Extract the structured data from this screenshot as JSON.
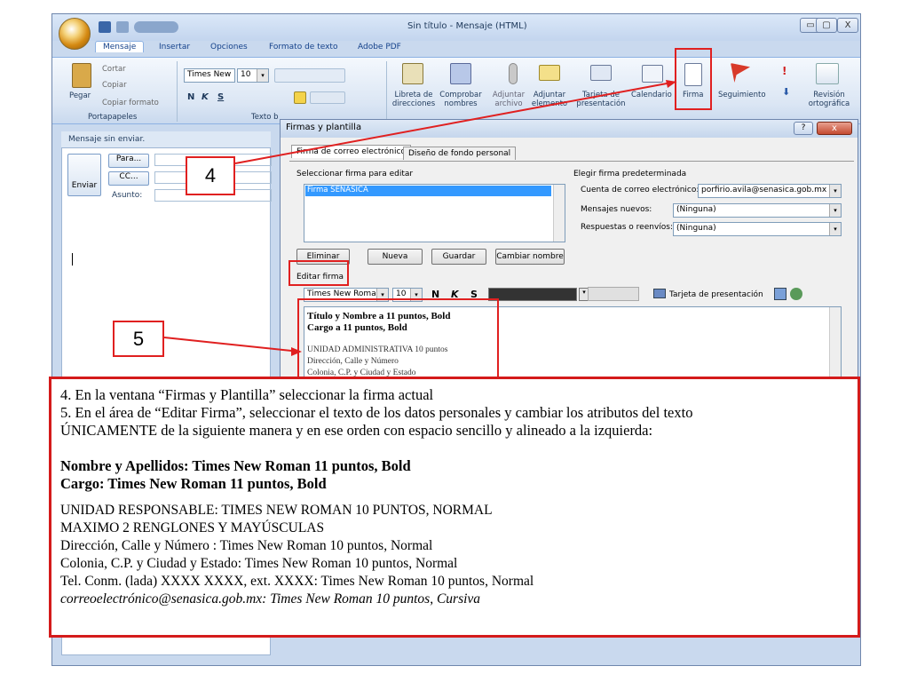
{
  "window": {
    "title": "Sin título - Mensaje (HTML)",
    "min": "▭",
    "max": "▢",
    "close": "X"
  },
  "tabs": [
    "Mensaje",
    "Insertar",
    "Opciones",
    "Formato de texto",
    "Adobe PDF"
  ],
  "ribbon": {
    "paste": "Pegar",
    "cut": "Cortar",
    "copy": "Copiar",
    "format_painter": "Copiar formato",
    "font": "Times New",
    "size": "10",
    "group_clipboard": "Portapapeles",
    "group_text": "Texto b",
    "address_book": "Libreta de direcciones",
    "check_names": "Comprobar nombres",
    "attach_file": "Adjuntar archivo",
    "attach_item": "Adjuntar elemento",
    "business_card": "Tarjeta de presentación",
    "calendar": "Calendario",
    "signature": "Firma",
    "followup": "Seguimiento",
    "spelling": "Revisión ortográfica",
    "bold_glyph": "N",
    "italic_glyph": "K",
    "underline_glyph": "S"
  },
  "message": {
    "status": "Mensaje sin enviar.",
    "send": "Enviar",
    "to": "Para...",
    "cc": "CC...",
    "subject": "Asunto:"
  },
  "dialog": {
    "title": "Firmas y plantilla",
    "help": "?",
    "close": "x",
    "tab_email_sig": "Firma de correo electrónico",
    "tab_stationery": "Diseño de fondo personal",
    "select_sig_label": "Seleccionar firma para editar",
    "selected_sig": "Firma SENASICA",
    "default_sig_label": "Elegir firma predeterminada",
    "email_account_label": "Cuenta de correo electrónico:",
    "email_account_value": "porfirio.avila@senasica.gob.mx",
    "new_messages_label": "Mensajes nuevos:",
    "new_messages_value": "(Ninguna)",
    "replies_label": "Respuestas o reenvíos:",
    "replies_value": "(Ninguna)",
    "btn_delete": "Eliminar",
    "btn_new": "Nueva",
    "btn_save": "Guardar",
    "btn_rename": "Cambiar nombre",
    "edit_sig_label": "Editar firma",
    "edit_font": "Times New Roman",
    "edit_size": "10",
    "business_card": "Tarjeta de presentación",
    "sig_line1": "Título y Nombre a 11 puntos, Bold",
    "sig_line2": "Cargo a 11 puntos, Bold",
    "sig_line3": "UNIDAD ADMINISTRATIVA 10 puntos",
    "sig_line4": "Dirección, Calle y Número",
    "sig_line5": "Colonia, C.P. y Ciudad y Estado"
  },
  "callouts": {
    "n4": "4",
    "n5": "5"
  },
  "instructions": {
    "line1": "4. En la ventana “Firmas y Plantilla” seleccionar la firma actual",
    "line2": "5. En el área de “Editar Firma”, seleccionar el texto de los datos personales y cambiar los atributos del texto",
    "line3": "ÚNICAMENTE de la siguiente manera y en ese orden con espacio sencillo y alineado a la izquierda:",
    "bold1": "Nombre y Apellidos: Times New Roman 11 puntos, Bold",
    "bold2": "Cargo: Times New Roman 11 puntos, Bold",
    "n1": "UNIDAD RESPONSABLE: TIMES NEW ROMAN 10 PUNTOS, NORMAL",
    "n2": "MAXIMO 2 RENGLONES Y MAYÚSCULAS",
    "n3": "Dirección, Calle y Número : Times New Roman 10 puntos, Normal",
    "n4": "Colonia, C.P. y Ciudad y Estado: Times New Roman 10 puntos, Normal",
    "n5": "Tel. Conm. (lada) XXXX XXXX, ext. XXXX: Times New Roman 10 puntos, Normal",
    "n6": "correoelectrónico@senasica.gob.mx: Times New Roman 10 puntos, Cursiva"
  }
}
